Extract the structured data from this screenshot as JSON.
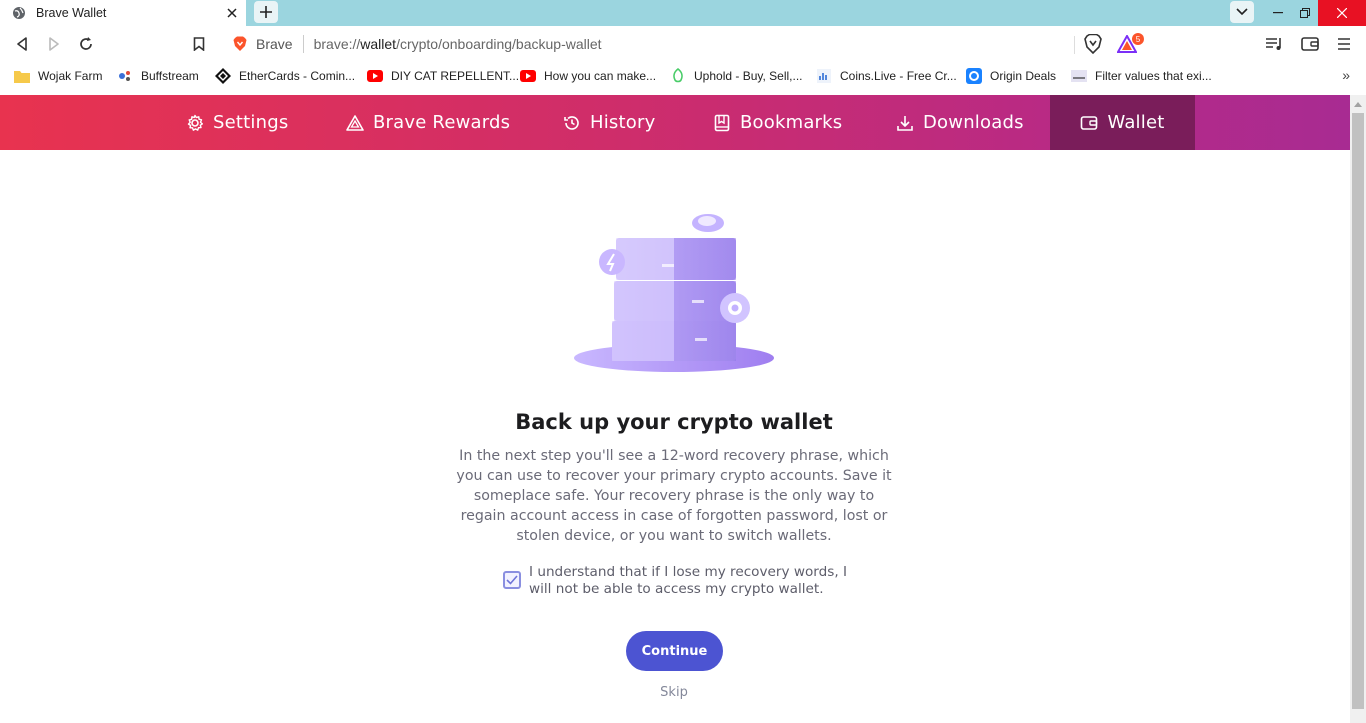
{
  "tab": {
    "title": "Brave Wallet"
  },
  "toolbar": {
    "site_name": "Brave",
    "url_prefix": "brave://",
    "url_host": "wallet",
    "url_path": "/crypto/onboarding/backup-wallet",
    "rewards_badge": "5"
  },
  "bookmarks": [
    {
      "label": "Wojak Farm",
      "icon": "folder-icon"
    },
    {
      "label": "Buffstream",
      "icon": "buffstream-icon"
    },
    {
      "label": "EtherCards - Comin...",
      "icon": "ethercards-icon"
    },
    {
      "label": "DIY CAT REPELLENT...",
      "icon": "youtube-icon"
    },
    {
      "label": "How you can make...",
      "icon": "youtube-icon"
    },
    {
      "label": "Uphold - Buy, Sell,...",
      "icon": "uphold-icon"
    },
    {
      "label": "Coins.Live - Free Cr...",
      "icon": "coinslive-icon"
    },
    {
      "label": "Origin Deals",
      "icon": "origin-icon"
    },
    {
      "label": "Filter values that exi...",
      "icon": "sdh-icon"
    }
  ],
  "nav": {
    "settings": "Settings",
    "rewards": "Brave Rewards",
    "history": "History",
    "bookmarks": "Bookmarks",
    "downloads": "Downloads",
    "wallet": "Wallet"
  },
  "content": {
    "heading": "Back up your crypto wallet",
    "description": "In the next step you'll see a 12-word recovery phrase, which you can use to recover your primary crypto accounts. Save it someplace safe. Your recovery phrase is the only way to regain account access in case of forgotten password, lost or stolen device, or you want to switch wallets.",
    "acknowledge": "I understand that if I lose my recovery words, I will not be able to access my crypto wallet.",
    "acknowledge_checked": true,
    "continue_label": "Continue",
    "skip_label": "Skip"
  },
  "colors": {
    "nav_gradient_start": "#e8334f",
    "nav_gradient_end": "#a82b92",
    "nav_active": "#7a1d5a",
    "primary_button": "#4c54d2",
    "tabstrip": "#9bd5df"
  }
}
